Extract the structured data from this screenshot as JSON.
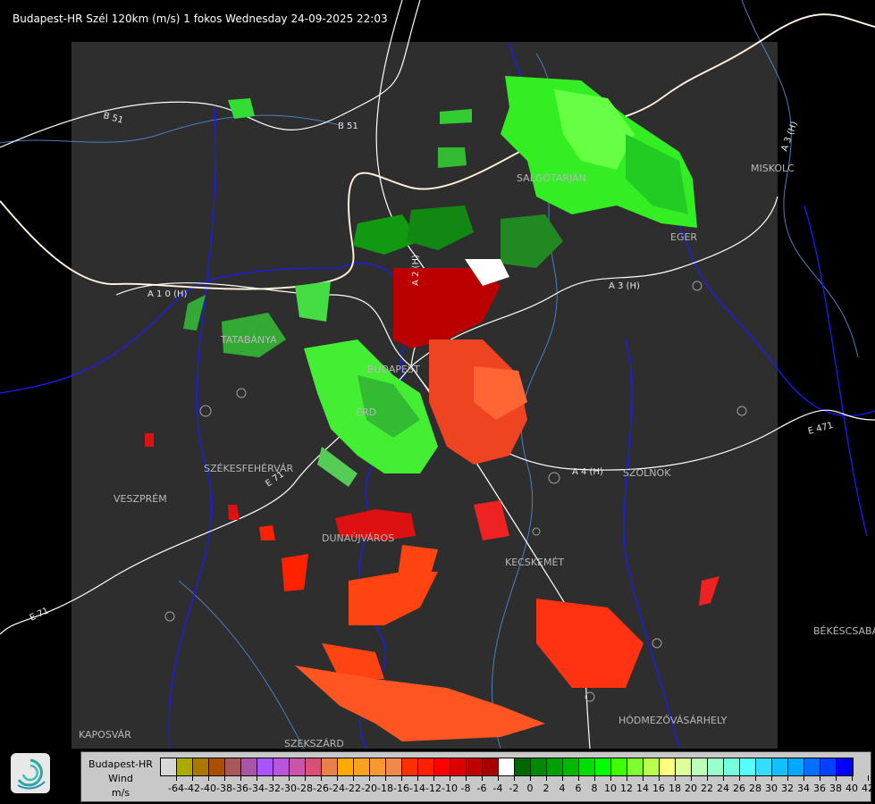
{
  "title": "Budapest-HR Szél 120km (m/s) 1 fokos Wednesday 24-09-2025 22:03",
  "map": {
    "cities": [
      "TATABÁNYA",
      "BUDAPEST",
      "ÉRD",
      "SZÉKESFEHÉRVÁR",
      "VESZPRÉM",
      "DUNAÚJVÁROS",
      "KECSKEMÉT",
      "SZOLNOK",
      "EGER",
      "MISKOLC",
      "SALGÓTARJÁN",
      "BÉKÉSCSABA",
      "HÓDMEZŐVÁSÁRHELY",
      "KAPOSVÁR",
      "SZEKSZÁRD"
    ],
    "roads": [
      "B 51",
      "B 51",
      "A 1 0 (H)",
      "A 2 (H)",
      "A 3 (H)",
      "A 4 (H)",
      "E 471",
      "A 3 (H)",
      "E 71",
      "E 71"
    ],
    "colors": {
      "background": "#000000",
      "radar_area": "#2e2e2e",
      "rivers": "#1a1aff",
      "borders": "#ffffff",
      "county_lines": "#4a7fbf",
      "town_outlines": "#a0a0a0"
    }
  },
  "logo": {
    "icon": "swirl-logo-icon"
  },
  "legend": {
    "name_lines": [
      "Budapest-HR",
      "Wind",
      "m/s"
    ],
    "colors": [
      "#d8d8d8",
      "#aaaa00",
      "#a87800",
      "#a85000",
      "#a85858",
      "#a855a8",
      "#a855ff",
      "#b855d8",
      "#c855a8",
      "#d85078",
      "#e88048",
      "#ffaa00",
      "#f8a020",
      "#f89830",
      "#f08848",
      "#ff3000",
      "#ff2000",
      "#ff0000",
      "#dd0000",
      "#c00000",
      "#a80000",
      "#ffffff",
      "#006600",
      "#008800",
      "#00a000",
      "#00b800",
      "#00dd00",
      "#00ff00",
      "#40ff00",
      "#80ff30",
      "#b8ff50",
      "#ffff80",
      "#ddff99",
      "#bbffbb",
      "#99ffcc",
      "#77ffdd",
      "#55ffff",
      "#33ddff",
      "#11c0ff",
      "#00a8ff",
      "#0070ff",
      "#0040ff",
      "#0000ff"
    ],
    "labels": [
      "-64",
      "-42",
      "-40",
      "-38",
      "-36",
      "-34",
      "-32",
      "-30",
      "-28",
      "-26",
      "-24",
      "-22",
      "-20",
      "-18",
      "-16",
      "-14",
      "-12",
      "-10",
      "-8",
      "-6",
      "-4",
      "-2",
      "0",
      "2",
      "4",
      "6",
      "8",
      "10",
      "12",
      "14",
      "16",
      "18",
      "20",
      "22",
      "24",
      "26",
      "28",
      "30",
      "32",
      "34",
      "36",
      "38",
      "40",
      "42"
    ]
  }
}
